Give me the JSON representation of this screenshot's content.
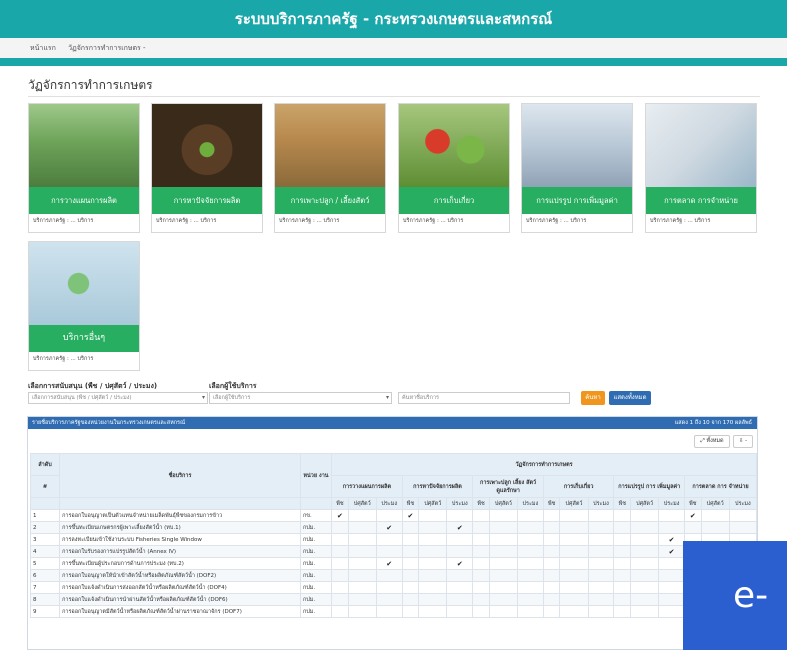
{
  "header": {
    "title": "ระบบบริการภาครัฐ - กระทรวงเกษตรและสหกรณ์"
  },
  "breadcrumb": {
    "home": "หน้าแรก",
    "current": "วัฏจักรการทำการเกษตร -"
  },
  "page": {
    "title": "วัฏจักรการทำการเกษตร"
  },
  "cards": [
    {
      "label": "การวางแผนการผลิต",
      "sub": "บริการภาครัฐ : ... บริการ"
    },
    {
      "label": "การหาปัจจัยการผลิต",
      "sub": "บริการภาครัฐ : ... บริการ"
    },
    {
      "label": "การเพาะปลูก / เลี้ยงสัตว์",
      "sub": "บริการภาครัฐ : ... บริการ"
    },
    {
      "label": "การเก็บเกี่ยว",
      "sub": "บริการภาครัฐ : ... บริการ"
    },
    {
      "label": "การแปรรูป การเพิ่มมูลค่า",
      "sub": "บริการภาครัฐ : ... บริการ"
    },
    {
      "label": "การตลาด การจำหน่าย",
      "sub": "บริการภาครัฐ : ... บริการ"
    },
    {
      "label": "บริการอื่นๆ",
      "sub": "บริการภาครัฐ : ... บริการ"
    }
  ],
  "filters": {
    "support_label": "เลือกการสนับสนุน (พืช / ปศุสัตว์ / ประมง)",
    "support_placeholder": "เลือกการสนับสนุน (พืช / ปศุสัตว์ / ประมง)",
    "user_label": "เลือกผู้ใช้บริการ",
    "user_placeholder": "เลือกผู้ใช้บริการ",
    "search_placeholder": "ค้นหาชื่อบริการ",
    "search_button": "ค้นหา",
    "showall_button": "แสดงทั้งหมด"
  },
  "table": {
    "caption": "รายชื่อบริการภาครัฐของหน่วยงานในกระทรวงเกษตรและสหกรณ์",
    "summary": "แสดง 1 ถึง 10 จาก 170 ผลลัพธ์",
    "show_all": "ทั้งหมด",
    "export": "⇩ -",
    "col_no": "ลำดับ",
    "col_no_sub": "#",
    "col_name": "ชื่อบริการ",
    "col_unit": "หน่วย งาน",
    "col_cycle": "วัฏจักรการทำการเกษตร",
    "groups": [
      "การวางแผนการผลิต",
      "การหาปัจจัยการผลิต",
      "การเพาะปลูก เลี้ยง สัตว์ ดูแลรักษา",
      "การเก็บเกี่ยว",
      "การแปรรูป การ เพิ่มมูลค่า",
      "การตลาด การ จำหน่าย"
    ],
    "subcols": [
      "พืช",
      "ปศุสัตว์",
      "ประมง"
    ],
    "rows": [
      {
        "no": "1",
        "name": "การออกใบอนุญาตเป็นตัวแทนจำหน่ายเมล็ดพันธุ์พืชของกรมการข้าว",
        "unit": "กข.",
        "checks": [
          0,
          3
        ]
      },
      {
        "no": "2",
        "name": "การขึ้นทะเบียนเกษตรกรผู้เพาะเลี้ยงสัตว์น้ำ (ทบ.1)",
        "unit": "กปม.",
        "checks": [
          2,
          5
        ]
      },
      {
        "no": "3",
        "name": "การลงทะเบียนเข้าใช้งานระบบ Fisheries Single Window",
        "unit": "กปม.",
        "checks": []
      },
      {
        "no": "4",
        "name": "การออกใบรับรองการแปรรูปสัตว์น้ำ (Annex IV)",
        "unit": "กปม.",
        "checks": []
      },
      {
        "no": "5",
        "name": "การขึ้นทะเบียนผู้ประกอบการด้านการประมง (ทบ.2)",
        "unit": "กปม.",
        "checks": [
          2,
          5
        ]
      },
      {
        "no": "6",
        "name": "การออกใบอนุญาตให้นำเข้าสัตว์น้ำหรือผลิตภัณฑ์สัตว์น้ำ (DOF2)",
        "unit": "กปม.",
        "checks": []
      },
      {
        "no": "7",
        "name": "การออกใบแจ้งดำเนินการส่งออกสัตว์น้ำหรือผลิตภัณฑ์สัตว์น้ำ (DOF4)",
        "unit": "กปม.",
        "checks": []
      },
      {
        "no": "8",
        "name": "การออกใบแจ้งดำเนินการนำผ่านสัตว์น้ำหรือผลิตภัณฑ์สัตว์น้ำ (DOF6)",
        "unit": "กปม.",
        "checks": []
      },
      {
        "no": "9",
        "name": "การออกใบอนุญาตมีสัตว์น้ำหรือผลิตภัณฑ์สัตว์น้ำผ่านราชอาณาจักร (DOF7)",
        "unit": "กปม.",
        "checks": []
      }
    ],
    "extra_checks": {
      "r1_col15": true,
      "r3_col14": true,
      "r4_col14": true
    }
  },
  "overlay": {
    "text": "e-"
  }
}
